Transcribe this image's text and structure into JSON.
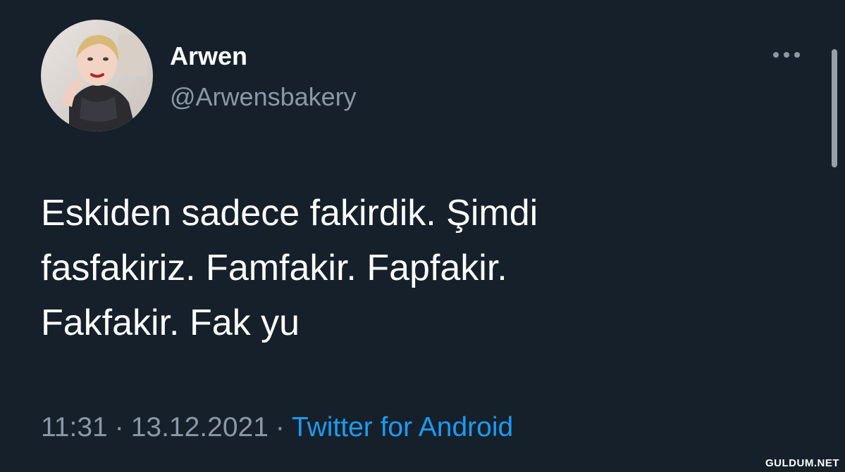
{
  "tweet": {
    "author": {
      "display_name": "Arwen",
      "handle": "@Arwensbakery",
      "avatar_icon": "profile-photo"
    },
    "more_icon": "more-horizontal-icon",
    "text": "Eskiden sadece fakirdik. Şimdi\nfasfakiriz. Famfakir. Fapfakir.\nFakfakir. Fak yu",
    "time": "11:31",
    "separator": "·",
    "date": "13.12.2021",
    "source": "Twitter for Android"
  },
  "watermark": "GULDUM.NET",
  "colors": {
    "background": "#15202b",
    "text": "#ffffff",
    "secondary_text": "#8b98a5",
    "link": "#1d9bf0"
  }
}
